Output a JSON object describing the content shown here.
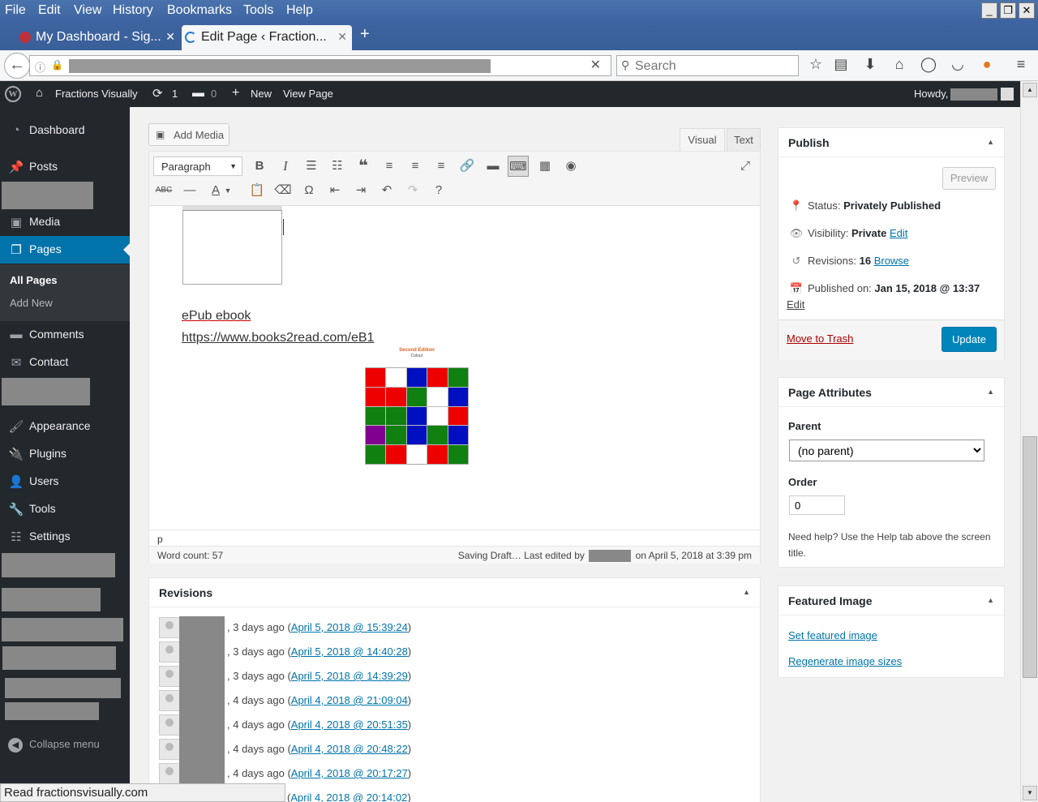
{
  "browser": {
    "menus": [
      "File",
      "Edit",
      "View",
      "History",
      "Bookmarks",
      "Tools",
      "Help"
    ],
    "tabs": [
      {
        "title": "My Dashboard - Sig...",
        "active": false
      },
      {
        "title": "Edit Page ‹ Fraction...",
        "active": true
      }
    ],
    "new_tab": "+",
    "search_placeholder": "Search",
    "status_text": "Read fractionsvisually.com"
  },
  "adminbar": {
    "site_name": "Fractions Visually",
    "updates_count": "1",
    "comments_count": "0",
    "new_label": "New",
    "view_page": "View Page",
    "howdy": "Howdy,"
  },
  "sidebar": {
    "dashboard": "Dashboard",
    "posts": "Posts",
    "media": "Media",
    "pages": "Pages",
    "all_pages": "All Pages",
    "add_new": "Add New",
    "comments": "Comments",
    "contact": "Contact",
    "appearance": "Appearance",
    "plugins": "Plugins",
    "users": "Users",
    "tools": "Tools",
    "settings": "Settings",
    "collapse": "Collapse menu"
  },
  "editor": {
    "add_media": "Add Media",
    "tab_visual": "Visual",
    "tab_text": "Text",
    "format_select": "Paragraph",
    "content_line1": "ePub ebook",
    "content_line2": "https://www.books2read.com/eB1",
    "cover_title": "Second Edition",
    "cover_subtitle": "Colour",
    "path": "p",
    "word_count": "Word count: 57",
    "last_edited_pre": "Saving Draft… Last edited by",
    "last_edited_post": "on April 5, 2018 at 3:39 pm"
  },
  "revisions": {
    "title": "Revisions",
    "items": [
      {
        "ago": ", 3 days ago (",
        "date": "April 5, 2018 @ 15:39:24",
        "close": ")"
      },
      {
        "ago": ", 3 days ago (",
        "date": "April 5, 2018 @ 14:40:28",
        "close": ")"
      },
      {
        "ago": ", 3 days ago (",
        "date": "April 5, 2018 @ 14:39:29",
        "close": ")"
      },
      {
        "ago": ", 4 days ago (",
        "date": "April 4, 2018 @ 21:09:04",
        "close": ")"
      },
      {
        "ago": ", 4 days ago (",
        "date": "April 4, 2018 @ 20:51:35",
        "close": ")"
      },
      {
        "ago": ", 4 days ago (",
        "date": "April 4, 2018 @ 20:48:22",
        "close": ")"
      },
      {
        "ago": ", 4 days ago (",
        "date": "April 4, 2018 @ 20:17:27",
        "close": ")"
      },
      {
        "ago": "(",
        "date": "April 4, 2018 @ 20:14:02",
        "close": ")"
      }
    ]
  },
  "publish": {
    "title": "Publish",
    "preview": "Preview",
    "status_label": "Status:",
    "status_value": "Privately Published",
    "visibility_label": "Visibility:",
    "visibility_value": "Private",
    "edit": "Edit",
    "revisions_label": "Revisions:",
    "revisions_value": "16",
    "browse": "Browse",
    "published_label": "Published on:",
    "published_value": "Jan 15, 2018 @ 13:37",
    "move_to_trash": "Move to Trash",
    "update": "Update"
  },
  "page_attributes": {
    "title": "Page Attributes",
    "parent_label": "Parent",
    "parent_value": "(no parent)",
    "order_label": "Order",
    "order_value": "0",
    "help": "Need help? Use the Help tab above the screen title."
  },
  "featured_image": {
    "title": "Featured Image",
    "set": "Set featured image",
    "regenerate": "Regenerate image sizes"
  },
  "colors": {
    "admin_dark": "#23282d",
    "accent": "#0073aa",
    "update_button": "#0085ba",
    "trash": "#a00"
  }
}
